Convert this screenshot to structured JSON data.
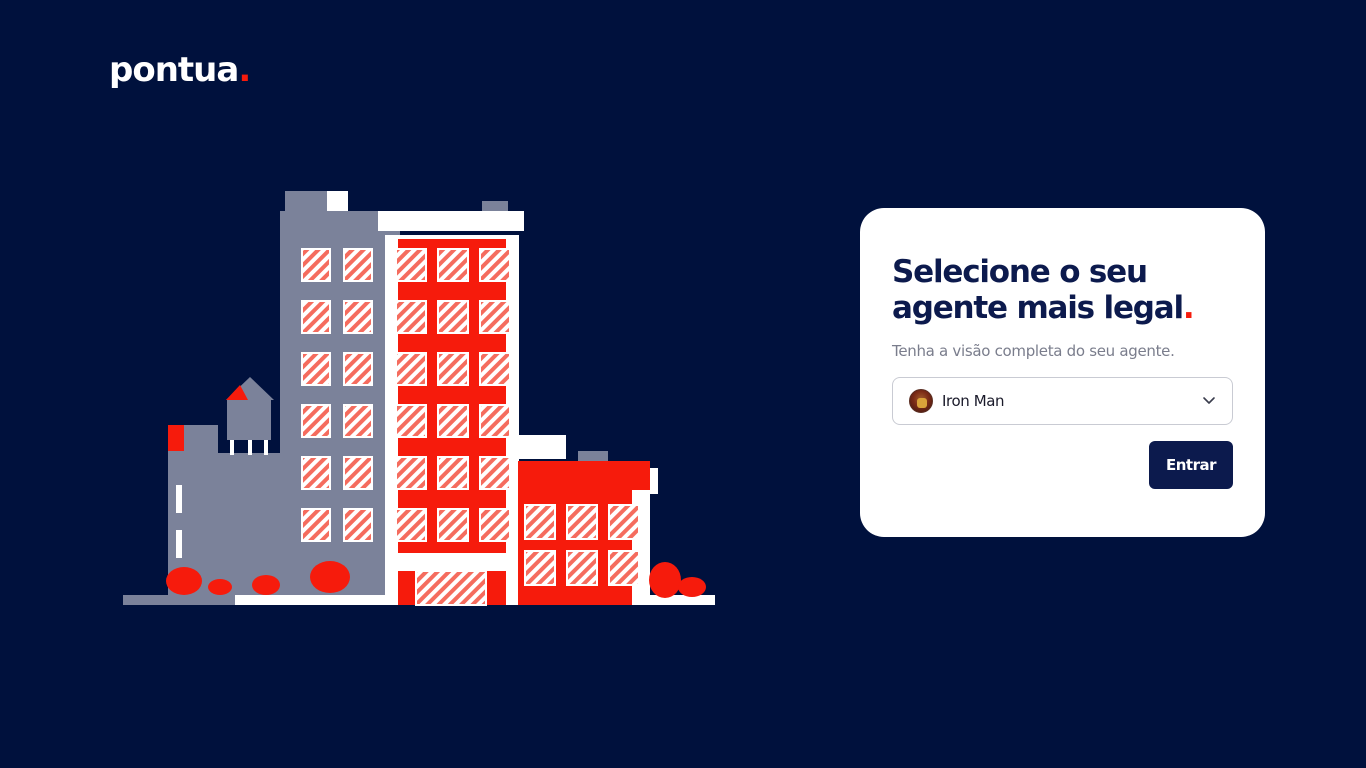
{
  "logo": {
    "text": "pontua",
    "dot": "."
  },
  "card": {
    "title_line1": "Selecione o seu",
    "title_line2": "agente mais legal",
    "title_dot": ".",
    "subtitle": "Tenha a visão completa do seu agente.",
    "agent_select": {
      "selected_value": "Iron Man",
      "avatar_icon": "iron-man-avatar",
      "dropdown_icon": "chevron-down-icon"
    },
    "submit_label": "Entrar"
  },
  "colors": {
    "background": "#00113d",
    "card": "#ffffff",
    "primary": "#0c1a4d",
    "accent": "#f61b0c",
    "building_gray": "#7b829a"
  }
}
